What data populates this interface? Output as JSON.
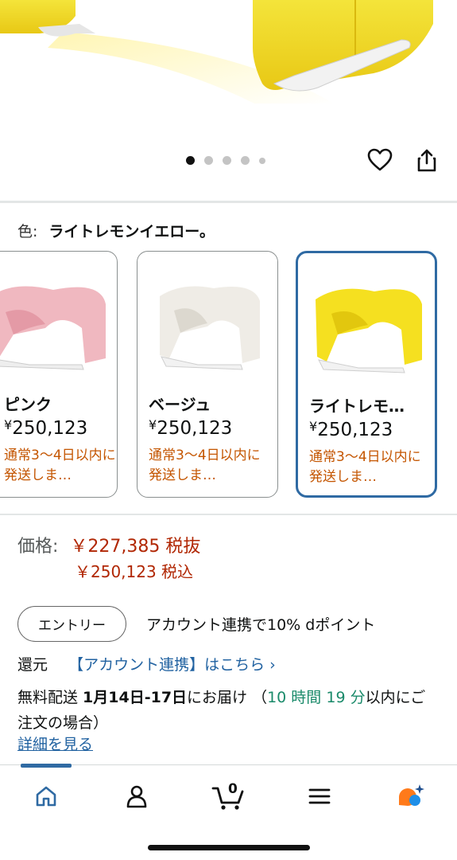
{
  "color_selector": {
    "label": "色:",
    "value": "ライトレモンイエロー。"
  },
  "carousel": {
    "total_dots": 5,
    "active_index": 0
  },
  "variants": [
    {
      "name": "ピンク",
      "price": "250,123",
      "currency": "¥",
      "shipping": "通常3～4日以内に発送しま…",
      "color": "#f0b8c0",
      "selected": false
    },
    {
      "name": "ベージュ",
      "price": "250,123",
      "currency": "¥",
      "shipping": "通常3～4日以内に発送しま…",
      "color": "#efece6",
      "selected": false
    },
    {
      "name": "ライトレモ…",
      "price": "250,123",
      "currency": "¥",
      "shipping": "通常3～4日以内に発送しま…",
      "color": "#f5e020",
      "selected": true
    }
  ],
  "price": {
    "label": "価格:",
    "excl_tax": "￥227,385 税抜",
    "incl_tax": "￥250,123 税込"
  },
  "entry": {
    "button_label": "エントリー",
    "text": "アカウント連携で10% dポイント"
  },
  "kangen": {
    "label": "還元",
    "link": "【アカウント連携】はこちら ›"
  },
  "delivery": {
    "prefix": "無料配送 ",
    "date": "1月14日-17日",
    "suffix": "にお届け （",
    "countdown": "10 時間 19 分",
    "after": "以内にご注文の場合）",
    "details_link": "詳細を見る"
  },
  "bottom_nav": {
    "items": [
      "home-icon",
      "account-icon",
      "cart-icon",
      "menu-icon",
      "assistant-icon"
    ],
    "cart_count": "0",
    "active": "home-icon"
  },
  "colors": {
    "accent_blue": "#2f6aa3",
    "price_red": "#b12704",
    "shipping_orange": "#c45500",
    "link_blue": "#2162a1",
    "countdown_teal": "#1a8a6a"
  }
}
